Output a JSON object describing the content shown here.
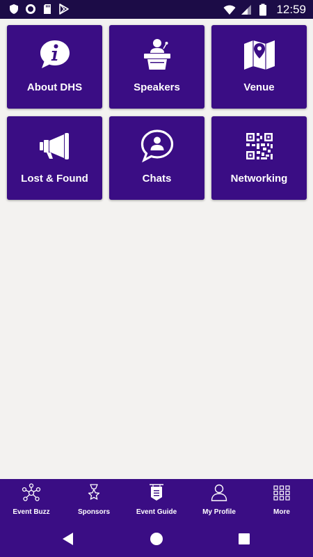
{
  "status_bar": {
    "time": "12:59",
    "left_icons": [
      "shield-icon",
      "record-icon",
      "sd-card-icon",
      "play-store-icon"
    ],
    "right_icons": [
      "wifi-icon",
      "signal-icon",
      "battery-icon"
    ]
  },
  "tiles": [
    {
      "label": "About DHS",
      "icon": "info-bubble-icon"
    },
    {
      "label": "Speakers",
      "icon": "podium-speaker-icon"
    },
    {
      "label": "Venue",
      "icon": "map-pin-icon"
    },
    {
      "label": "Lost & Found",
      "icon": "megaphone-icon"
    },
    {
      "label": "Chats",
      "icon": "chat-user-icon"
    },
    {
      "label": "Networking",
      "icon": "qr-code-icon"
    }
  ],
  "bottom_nav": [
    {
      "label": "Event Buzz",
      "icon": "network-icon"
    },
    {
      "label": "Sponsors",
      "icon": "star-trophy-icon"
    },
    {
      "label": "Event Guide",
      "icon": "guide-sign-icon"
    },
    {
      "label": "My Profile",
      "icon": "user-icon"
    },
    {
      "label": "More",
      "icon": "grid-icon"
    }
  ],
  "colors": {
    "primary": "#3a0d84",
    "status_bar": "#1c0c47",
    "background": "#f3f2f0",
    "text_on_primary": "#ffffff"
  }
}
